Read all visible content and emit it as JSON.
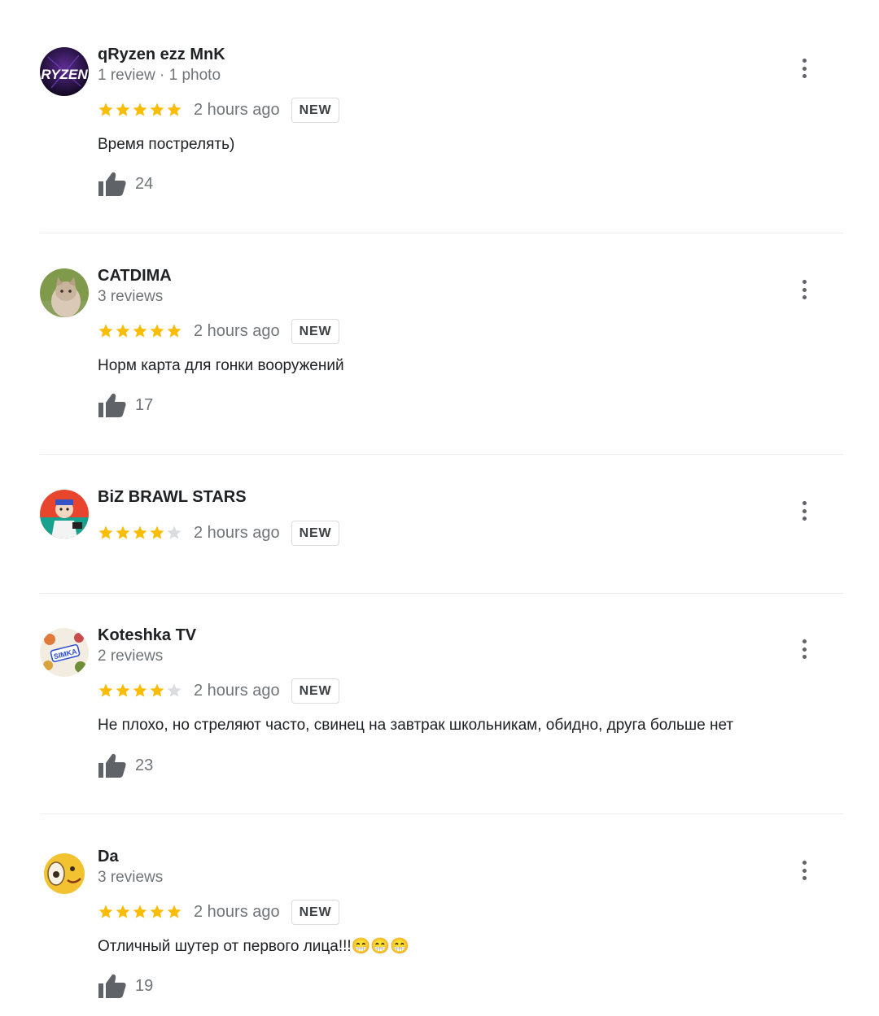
{
  "badge_label": "NEW",
  "star_color": "#fbbc04",
  "star_empty_color": "#dadce0",
  "reviews": [
    {
      "author": "qRyzen ezz MnK",
      "meta": "1 review · 1 photo",
      "rating": 5,
      "time": "2 hours ago",
      "text": "Время пострелять)",
      "likes": "24",
      "avatar": {
        "icon": "ryzen-logo-avatar",
        "text": "RYZEN"
      }
    },
    {
      "author": "CATDIMA",
      "meta": "3 reviews",
      "rating": 5,
      "time": "2 hours ago",
      "text": "Норм карта для гонки вооружений",
      "likes": "17",
      "avatar": {
        "icon": "cat-photo-avatar"
      }
    },
    {
      "author": "BiZ BRAWL STARS",
      "meta": "",
      "rating": 4,
      "time": "2 hours ago",
      "text": "",
      "likes": "",
      "avatar": {
        "icon": "brawler-character-avatar"
      }
    },
    {
      "author": "Koteshka TV",
      "meta": "2 reviews",
      "rating": 4,
      "time": "2 hours ago",
      "text": "Не плохо, но стреляют часто, свинец на завтрак школьникам, обидно, друга больше нет",
      "likes": "23",
      "avatar": {
        "icon": "sticker-collage-avatar",
        "text": "SIMKA"
      }
    },
    {
      "author": "Da",
      "meta": "3 reviews",
      "rating": 5,
      "time": "2 hours ago",
      "text": "Отличный шутер от первого лица!!!😁😁😁",
      "likes": "19",
      "avatar": {
        "icon": "cartoon-face-avatar"
      }
    }
  ]
}
